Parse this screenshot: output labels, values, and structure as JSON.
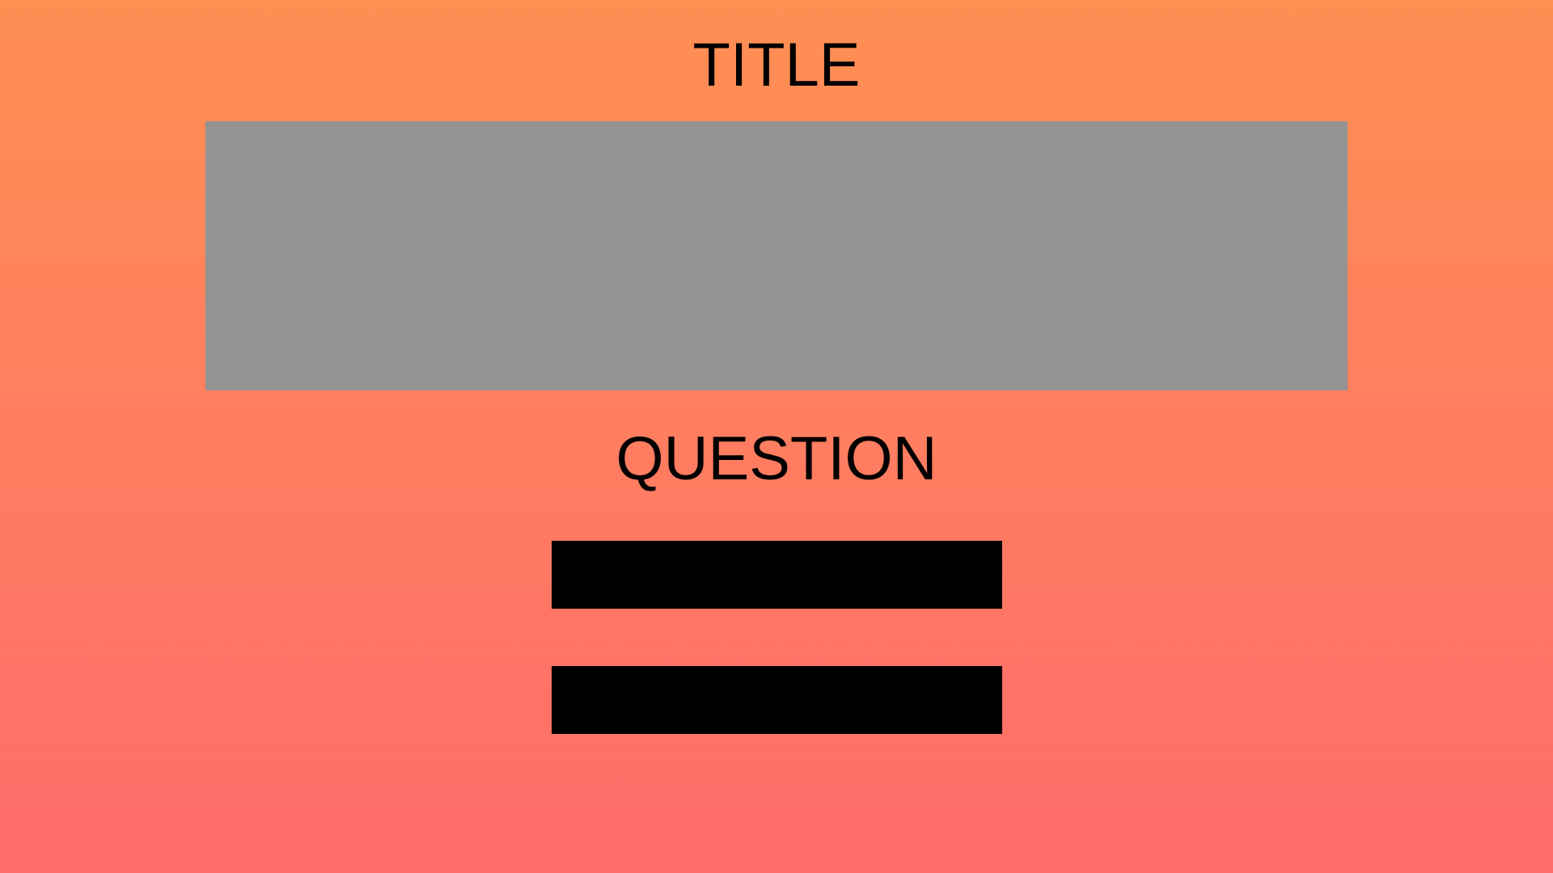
{
  "page": {
    "title": "TITLE",
    "question": "QUESTION"
  },
  "answers": [
    {
      "label": ""
    },
    {
      "label": ""
    }
  ],
  "colors": {
    "background_top": "#ff8f53",
    "background_bottom": "#ff6c6c",
    "panel": "#949494",
    "button": "#000000",
    "text": "#000000"
  }
}
